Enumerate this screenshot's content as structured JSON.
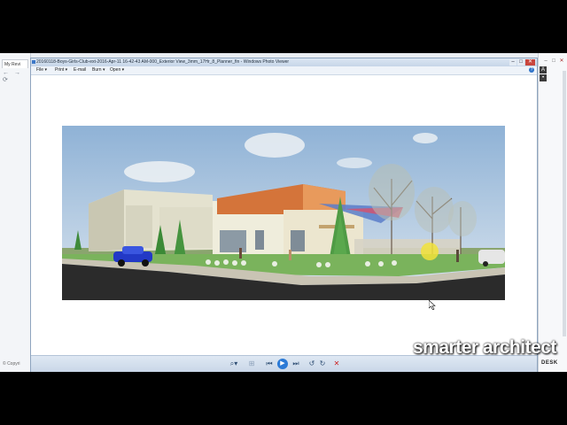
{
  "background_browser": {
    "tab_label": "My Revi",
    "nav_glyphs": "← → ⟳",
    "copyright": "© Copyri"
  },
  "right_window": {
    "footer_text": "DESK",
    "sidebar_icons": [
      "A",
      "•"
    ]
  },
  "viewer": {
    "title": "20160118-Boys-Girls-Club-ext-2016-Apr-11 16-42-43 AM-000_Exterior View_3mm_17Hr_8_Planner_fin - Windows Photo Viewer",
    "window_buttons": {
      "minimize": "–",
      "maximize": "□",
      "close": "✕"
    },
    "menu": [
      "File ▾",
      "Print ▾",
      "E-mail",
      "Burn ▾",
      "Open ▾"
    ],
    "help_icon": "?",
    "toolbar": {
      "zoom": "⌕▾",
      "fit": "⊞",
      "previous": "⏮",
      "slideshow": "▶",
      "next": "⏭",
      "rotate_ccw": "↺",
      "rotate_cw": "↻",
      "delete": "✕"
    }
  },
  "watermark": "smarter architect",
  "colors": {
    "screen_bg": "#e9edf2",
    "titlebar": "#c6d5e8",
    "sky": "#a9c4dc",
    "road": "#2b2b2b",
    "grass": "#6aa84f",
    "car": "#2239c6"
  }
}
